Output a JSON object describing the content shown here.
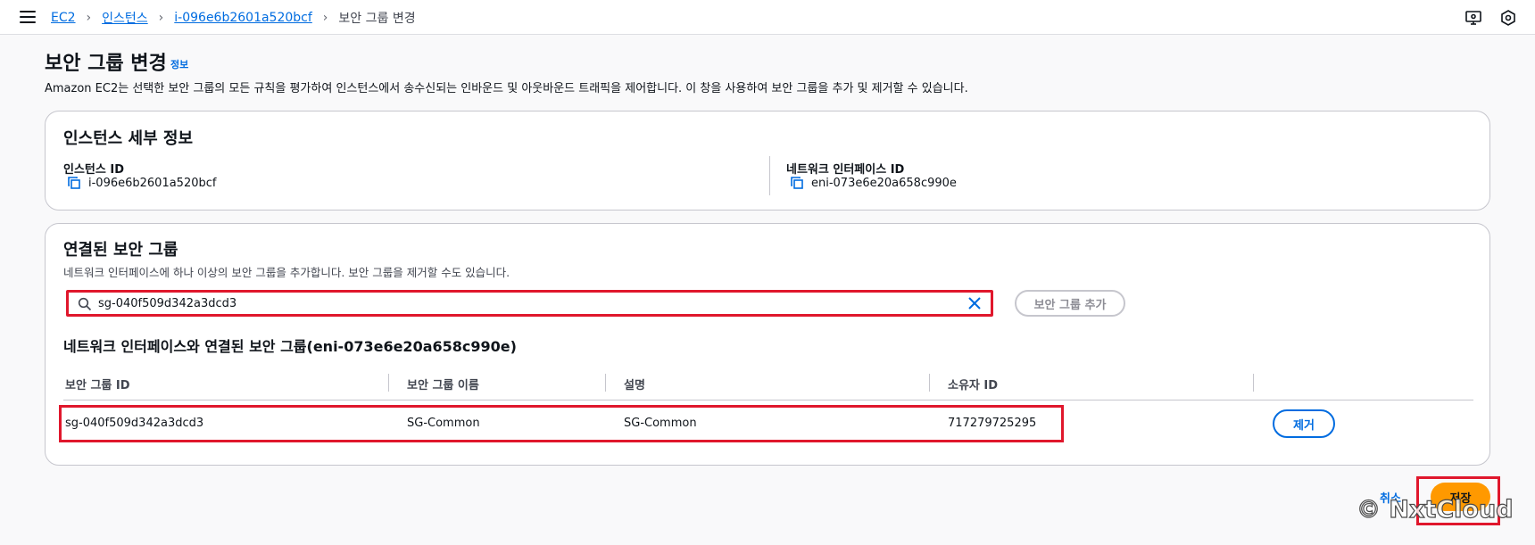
{
  "breadcrumb": {
    "items": [
      "EC2",
      "인스턴스",
      "i-096e6b2601a520bcf"
    ],
    "current": "보안 그룹 변경"
  },
  "header_icons": [
    "display-settings-icon",
    "settings-hex-icon"
  ],
  "page": {
    "title": "보안 그룹 변경",
    "info_label": "정보",
    "description": "Amazon EC2는 선택한 보안 그룹의 모든 규칙을 평가하여 인스턴스에서 송수신되는 인바운드 및 아웃바운드 트래픽을 제어합니다. 이 창을 사용하여 보안 그룹을 추가 및 제거할 수 있습니다."
  },
  "instance_details": {
    "title": "인스턴스 세부 정보",
    "instance_id_label": "인스턴스 ID",
    "instance_id": "i-096e6b2601a520bcf",
    "eni_label": "네트워크 인터페이스 ID",
    "eni_id": "eni-073e6e20a658c990e"
  },
  "security_groups": {
    "title": "연결된 보안 그룹",
    "description": "네트워크 인터페이스에 하나 이상의 보안 그룹을 추가합니다. 보안 그룹을 제거할 수도 있습니다.",
    "search_value": "sg-040f509d342a3dcd3",
    "add_button": "보안 그룹 추가",
    "table_title": "네트워크 인터페이스와 연결된 보안 그룹(eni-073e6e20a658c990e)",
    "columns": [
      "보안 그룹 ID",
      "보안 그룹 이름",
      "설명",
      "소유자 ID"
    ],
    "rows": [
      {
        "id": "sg-040f509d342a3dcd3",
        "name": "SG-Common",
        "description": "SG-Common",
        "owner": "717279725295",
        "action": "제거"
      }
    ]
  },
  "footer": {
    "cancel": "취소",
    "save": "저장"
  },
  "watermark": "© NxtCloud",
  "colors": {
    "link": "#006ce0",
    "primary_button": "#ff9900",
    "highlight": "#e0172c"
  }
}
